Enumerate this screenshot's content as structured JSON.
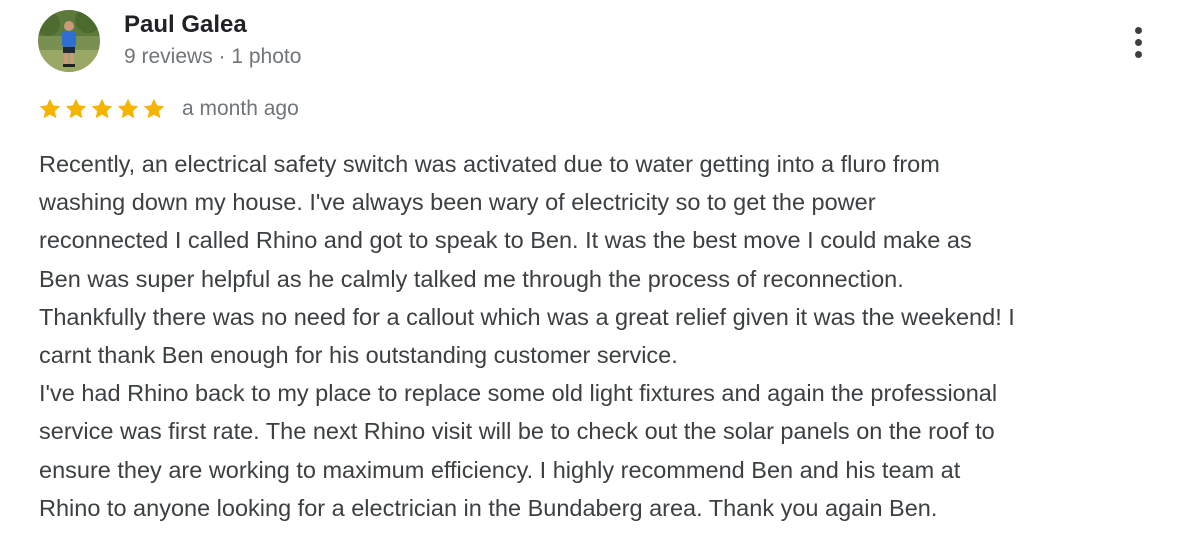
{
  "reviewer": {
    "name": "Paul Galea",
    "stats": "9 reviews · 1 photo"
  },
  "rating": {
    "stars": 5,
    "max_stars": 5,
    "time_ago": "a month ago"
  },
  "colors": {
    "star": "#f4b400",
    "name": "#202124",
    "secondary": "#70757a",
    "body": "#3c4043"
  },
  "icons": {
    "menu": "more-vert-icon",
    "star": "star-icon"
  },
  "review": {
    "lines": [
      "Recently, an electrical safety switch was activated due to water getting into a fluro from",
      "washing down my house. I've always been wary of electricity so to get the power",
      "reconnected I called Rhino and got to speak to Ben. It was the best move I could make as",
      "Ben was super helpful as he calmly talked me through the process of reconnection.",
      "Thankfully there was no need for a callout which was a great relief given it was the weekend! I",
      "carnt thank Ben enough for his outstanding customer service.",
      "I've had Rhino back to my place to replace some old light fixtures and again the professional",
      "service was first rate. The next Rhino visit will be to check out the solar panels on the roof to",
      "ensure they are working to maximum efficiency. I highly recommend Ben and his team at",
      "Rhino to anyone looking for a electrician in the Bundaberg area. Thank you again Ben."
    ]
  }
}
